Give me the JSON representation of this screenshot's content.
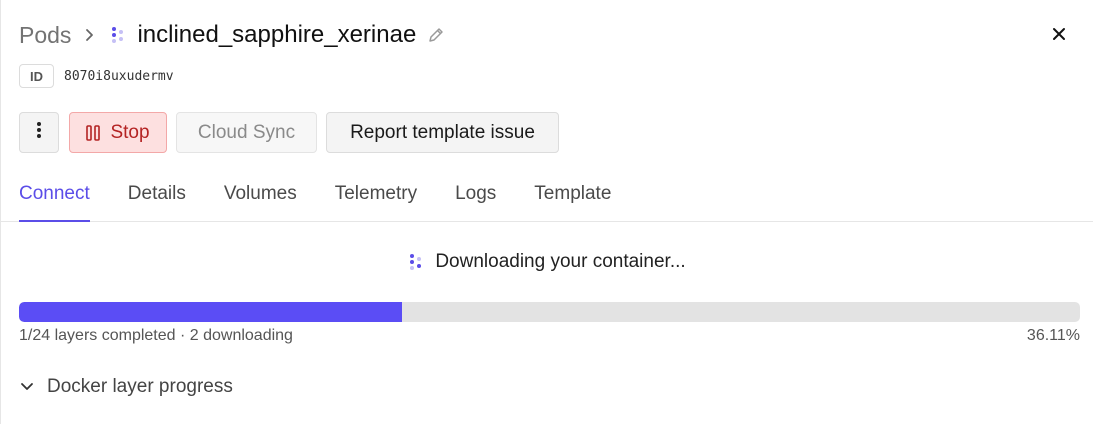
{
  "header": {
    "breadcrumb_root": "Pods",
    "pod_name": "inclined_sapphire_xerinae",
    "icons": {
      "separator": "chevron-right-icon",
      "pod": "dots-spinner-icon",
      "edit": "pencil-icon",
      "close": "close-icon"
    }
  },
  "id": {
    "label": "ID",
    "value": "8070i8uxudermv"
  },
  "toolbar": {
    "more_icon": "vertical-dots-icon",
    "stop_label": "Stop",
    "stop_icon": "pause-icon",
    "cloud_sync_label": "Cloud Sync",
    "report_label": "Report template issue"
  },
  "tabs": [
    {
      "label": "Connect",
      "active": true
    },
    {
      "label": "Details",
      "active": false
    },
    {
      "label": "Volumes",
      "active": false
    },
    {
      "label": "Telemetry",
      "active": false
    },
    {
      "label": "Logs",
      "active": false
    },
    {
      "label": "Template",
      "active": false
    }
  ],
  "status": {
    "text": "Downloading your container...",
    "icon": "dots-spinner-icon"
  },
  "progress": {
    "percent": 36.11,
    "percent_label": "36.11%",
    "summary": "1/24 layers completed · 2 downloading"
  },
  "docker": {
    "label": "Docker layer progress",
    "icon": "chevron-down-icon"
  },
  "colors": {
    "accent": "#5b4de8",
    "progress_fill": "#5b4df5",
    "stop_bg": "#fde0e0",
    "stop_text": "#b42323"
  }
}
